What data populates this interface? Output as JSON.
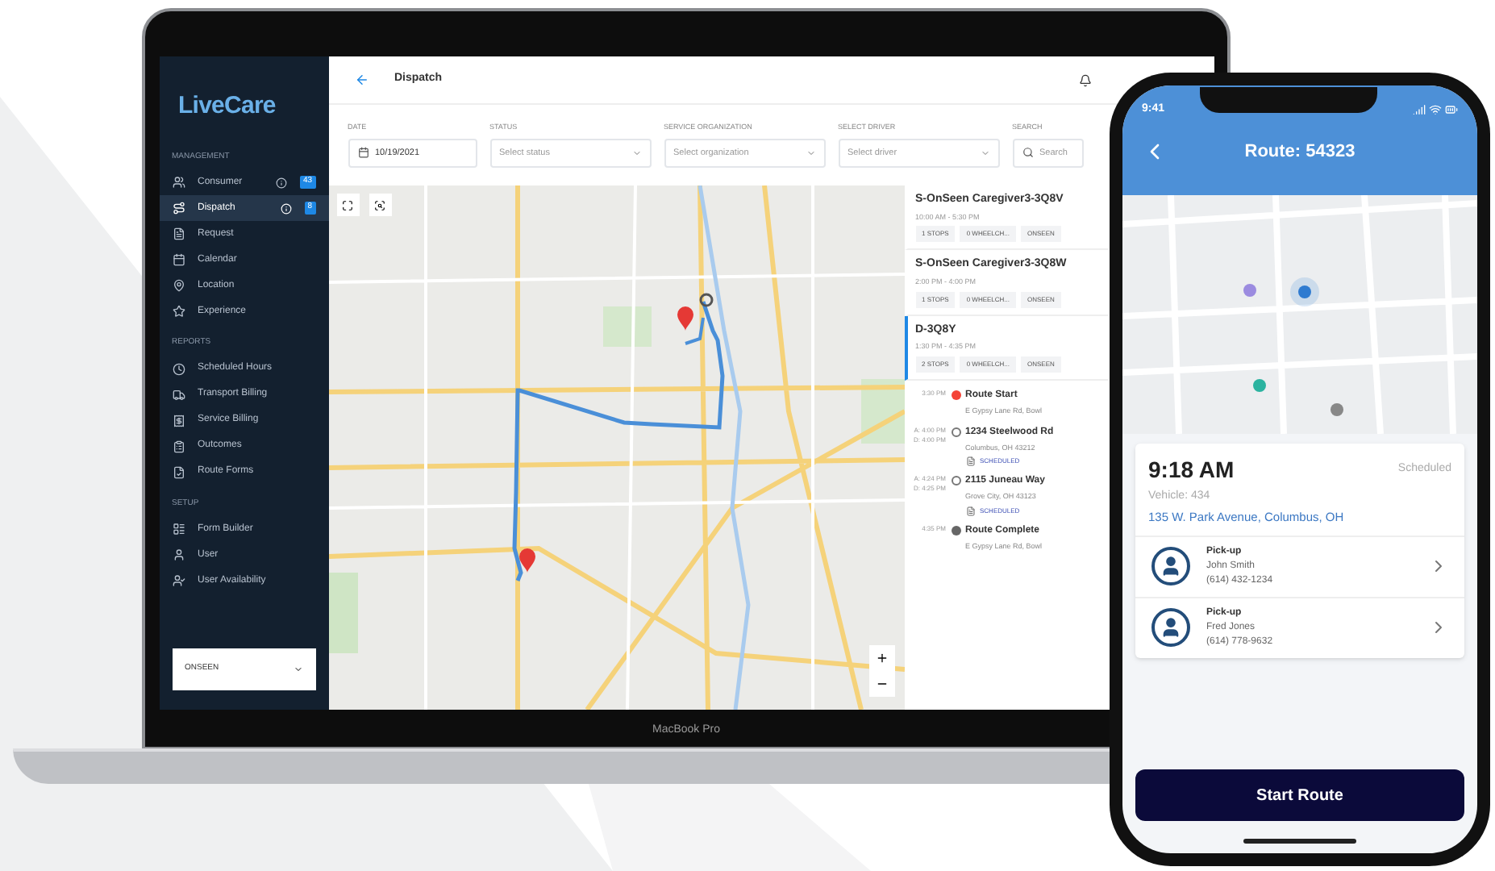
{
  "laptop": {
    "label": "MacBook Pro",
    "sidebar": {
      "logo": "LiveCare",
      "sections": [
        {
          "title": "MANAGEMENT",
          "items": [
            {
              "label": "Consumer",
              "selected": false,
              "badge": "43"
            },
            {
              "label": "Dispatch",
              "selected": true,
              "badge": "8"
            },
            {
              "label": "Request",
              "selected": false
            },
            {
              "label": "Calendar",
              "selected": false
            },
            {
              "label": "Location",
              "selected": false
            },
            {
              "label": "Experience",
              "selected": false
            }
          ]
        },
        {
          "title": "REPORTS",
          "items": [
            {
              "label": "Scheduled Hours",
              "selected": false
            },
            {
              "label": "Transport Billing",
              "selected": false
            },
            {
              "label": "Service Billing",
              "selected": false
            },
            {
              "label": "Outcomes",
              "selected": false
            },
            {
              "label": "Route Forms",
              "selected": false
            }
          ]
        },
        {
          "title": "SETUP",
          "items": [
            {
              "label": "Form Builder",
              "selected": false
            },
            {
              "label": "User",
              "selected": false
            },
            {
              "label": "User Availability",
              "selected": false
            }
          ]
        }
      ],
      "org_select": "ONSEEN"
    },
    "header": {
      "title": "Dispatch"
    },
    "filters": [
      {
        "kind": "date",
        "label": "DATE",
        "value": "10/19/2021"
      },
      {
        "kind": "select",
        "label": "STATUS",
        "placeholder": "Select status"
      },
      {
        "kind": "select",
        "label": "SERVICE ORGANIZATION",
        "placeholder": "Select organization"
      },
      {
        "kind": "select",
        "label": "SELECT DRIVER",
        "placeholder": "Select driver"
      },
      {
        "kind": "search",
        "label": "SEARCH",
        "placeholder": "Search"
      }
    ],
    "routes": [
      {
        "name": "S-OnSeen Caregiver3-3Q8V",
        "time": "10:00 AM - 5:30 PM",
        "selected": false,
        "chips": [
          "1 STOPS",
          "0 WHEELCH...",
          "ONSEEN"
        ]
      },
      {
        "name": "S-OnSeen Caregiver3-3Q8W",
        "time": "2:00 PM - 4:00 PM",
        "selected": false,
        "chips": [
          "1 STOPS",
          "0 WHEELCH...",
          "ONSEEN"
        ]
      },
      {
        "name": "D-3Q8Y",
        "time": "1:30 PM - 4:35 PM",
        "selected": true,
        "chips": [
          "2 STOPS",
          "0 WHEELCH...",
          "ONSEEN"
        ]
      }
    ],
    "stops": [
      {
        "kind": "start",
        "times": [
          "3:30 PM"
        ],
        "title": "Route Start",
        "address": "E Gypsy Lane Rd, Bowl"
      },
      {
        "kind": "stop",
        "times": [
          "A: 4:00 PM",
          "D: 4:00 PM"
        ],
        "title": "1234 Steelwood Rd",
        "address": "Columbus, OH 43212",
        "status": "SCHEDULED"
      },
      {
        "kind": "stop",
        "times": [
          "A: 4:24 PM",
          "D: 4:25 PM"
        ],
        "title": "2115 Juneau Way",
        "address": "Grove City, OH 43123",
        "status": "SCHEDULED"
      },
      {
        "kind": "end",
        "times": [
          "4:35 PM"
        ],
        "title": "Route Complete",
        "address": "E Gypsy Lane Rd, Bowl"
      }
    ]
  },
  "phone": {
    "clock": "9:41",
    "title": "Route: 54323",
    "trip": {
      "time": "9:18 AM",
      "status": "Scheduled",
      "vehicle": "Vehicle: 434",
      "address": "135 W. Park Avenue, Columbus, OH"
    },
    "pickups": [
      {
        "type": "Pick-up",
        "name": "John Smith",
        "phone": "(614) 432-1234"
      },
      {
        "type": "Pick-up",
        "name": "Fred Jones",
        "phone": "(614) 778-9632"
      }
    ],
    "button": "Start Route"
  }
}
